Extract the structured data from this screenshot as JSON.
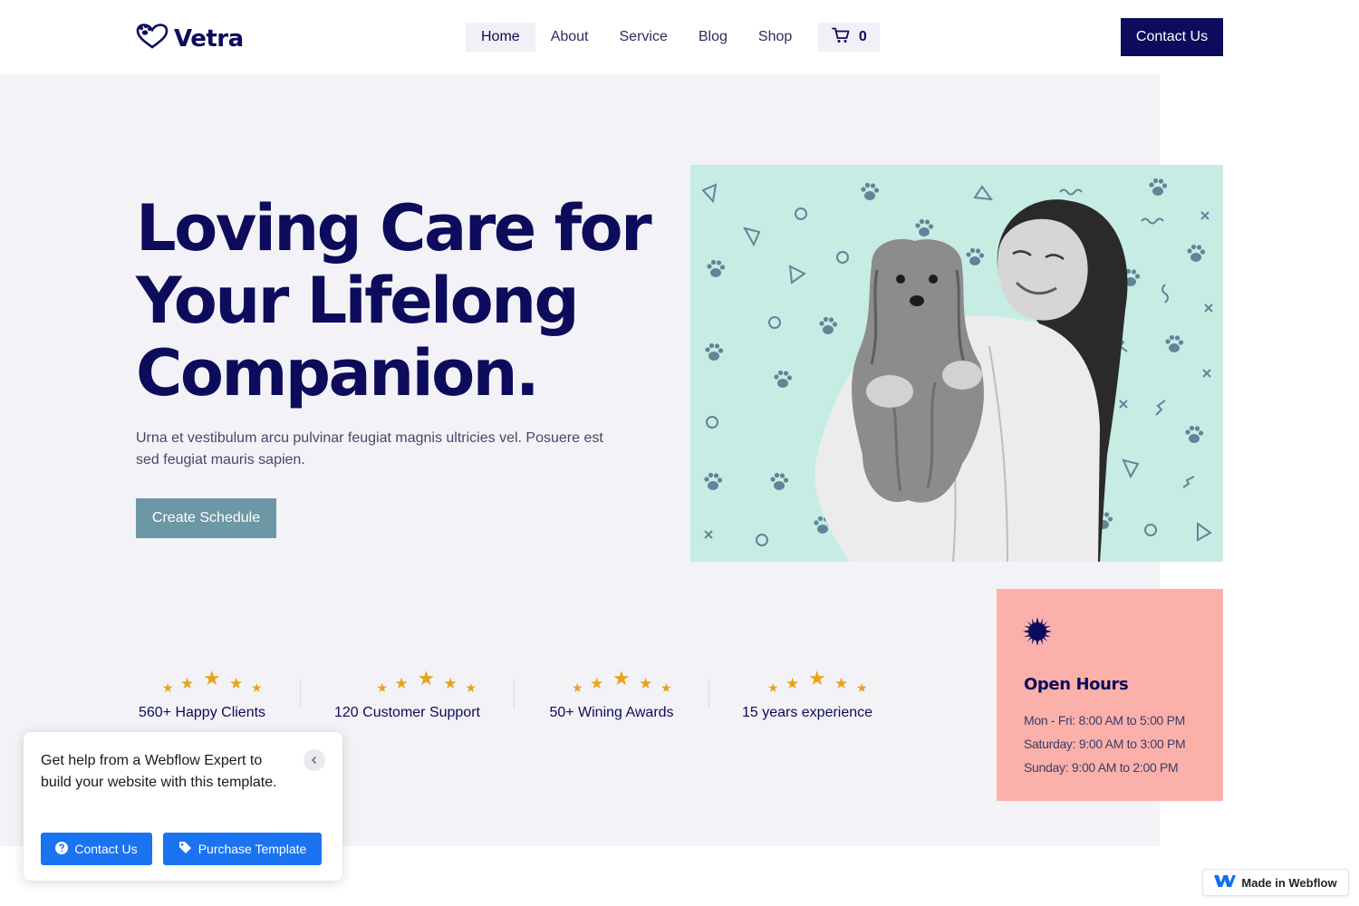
{
  "header": {
    "logo_text": "Vetra",
    "nav": [
      {
        "label": "Home",
        "active": true
      },
      {
        "label": "About"
      },
      {
        "label": "Service"
      },
      {
        "label": "Blog"
      },
      {
        "label": "Shop"
      }
    ],
    "cart_count": "0",
    "contact_label": "Contact Us"
  },
  "hero": {
    "title_line1": "Loving Care for",
    "title_line2": "Your Lifelong",
    "title_line3": "Companion.",
    "text": "Urna et vestibulum arcu pulvinar feugiat magnis ultricies vel. Posuere est sed feugiat mauris sapien.",
    "button_label": "Create Schedule"
  },
  "stats": [
    {
      "label": "560+ Happy Clients"
    },
    {
      "label": "120 Customer Support"
    },
    {
      "label": "50+ Wining Awards"
    },
    {
      "label": "15 years experience"
    }
  ],
  "hours": {
    "title": "Open Hours",
    "lines": [
      "Mon - Fri: 8:00 AM to 5:00 PM",
      "Saturday: 9:00 AM to 3:00 PM",
      "Sunday: 9:00 AM to 2:00 PM"
    ]
  },
  "popup": {
    "text": "Get help from a Webflow Expert to build your website with this template.",
    "contact_label": "Contact Us",
    "purchase_label": "Purchase Template"
  },
  "badge": {
    "label": "Made in Webflow"
  },
  "colors": {
    "navy": "#0d0b5c",
    "hero_bg": "#f3f3f7",
    "image_bg": "#c6ece4",
    "hours_bg": "#fbb1aa",
    "schedule_button": "#6c97a4",
    "star": "#e8a317",
    "popup_button": "#1a73f0"
  },
  "icons": [
    "heart-paw-logo-icon",
    "cart-icon",
    "sunburst-icon",
    "star-icon",
    "chevron-left-icon",
    "question-circle-icon",
    "tag-icon",
    "webflow-logo-icon"
  ]
}
